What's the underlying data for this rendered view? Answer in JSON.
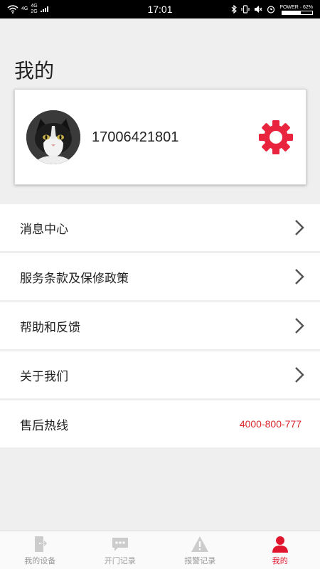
{
  "status_bar": {
    "time": "17:01",
    "network_top": "4G",
    "network_mid": "4G",
    "network_bottom": "2G",
    "battery_text": "POWER · 62%",
    "battery_level": 0.62
  },
  "header": {
    "title": "我的"
  },
  "profile": {
    "phone": "17006421801",
    "avatar_icon": "cat-avatar",
    "settings_icon": "gear-icon",
    "accent": "#e8243e"
  },
  "menu": [
    {
      "label": "消息中心"
    },
    {
      "label": "服务条款及保修政策"
    },
    {
      "label": "帮助和反馈"
    },
    {
      "label": "关于我们"
    }
  ],
  "hotline": {
    "label": "售后热线",
    "value": "4000-800-777"
  },
  "bottom_nav": {
    "tabs": [
      {
        "label": "我的设备",
        "icon": "door-icon",
        "active": false
      },
      {
        "label": "开门记录",
        "icon": "chat-icon",
        "active": false
      },
      {
        "label": "报警记录",
        "icon": "warning-icon",
        "active": false
      },
      {
        "label": "我的",
        "icon": "user-icon",
        "active": true
      }
    ],
    "active_color": "#e0142d",
    "inactive_color": "#cccccc"
  }
}
